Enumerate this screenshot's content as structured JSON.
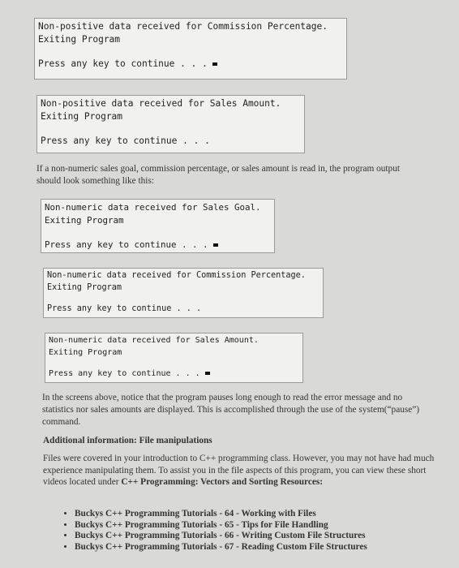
{
  "console_boxes": [
    {
      "line1": "Non-positive data received for Commission Percentage.",
      "line2": "Exiting Program",
      "prompt": "Press any key to continue . . .",
      "cursor": true
    },
    {
      "line1": "Non-positive data received for Sales Amount.",
      "line2": "Exiting Program",
      "prompt": "Press any key to continue . . .",
      "cursor": false
    },
    {
      "line1": "Non-numeric data received for Sales Goal.",
      "line2": "Exiting Program",
      "prompt": "Press any key to continue . . .",
      "cursor": true
    },
    {
      "line1": "Non-numeric data received for Commission Percentage.",
      "line2": "Exiting Program",
      "prompt": "Press any key to continue . . .",
      "cursor": false
    },
    {
      "line1": "Non-numeric data received for Sales Amount.",
      "line2": "Exiting Program",
      "prompt": "Press any key to continue . . .",
      "cursor": true
    }
  ],
  "intro_paragraph": "If a non-numeric sales goal, commission percentage, or sales amount is read in, the program output should look something like this:",
  "pause_paragraph": "In the screens above, notice that the program pauses long enough to read the error message and no statistics nor sales amounts are displayed. This is accomplished through the use of the system(“pause”) command.",
  "heading": "Additional information: File manipulations",
  "files_paragraph": {
    "text": "Files were covered in your introduction to C++ programming class. However, you may not have had much experience manipulating them. To assist you in the file aspects of this program, you can view these short videos located under ",
    "bold": "C++ Programming: Vectors and Sorting Resources:"
  },
  "resources": [
    "Buckys C++ Programming Tutorials - 64 - Working with Files",
    "Buckys C++ Programming Tutorials - 65 - Tips for File Handling",
    "Buckys C++ Programming Tutorials - 66 - Writing Custom File Structures",
    "Buckys C++ Programming Tutorials - 67 - Reading Custom File Structures"
  ]
}
